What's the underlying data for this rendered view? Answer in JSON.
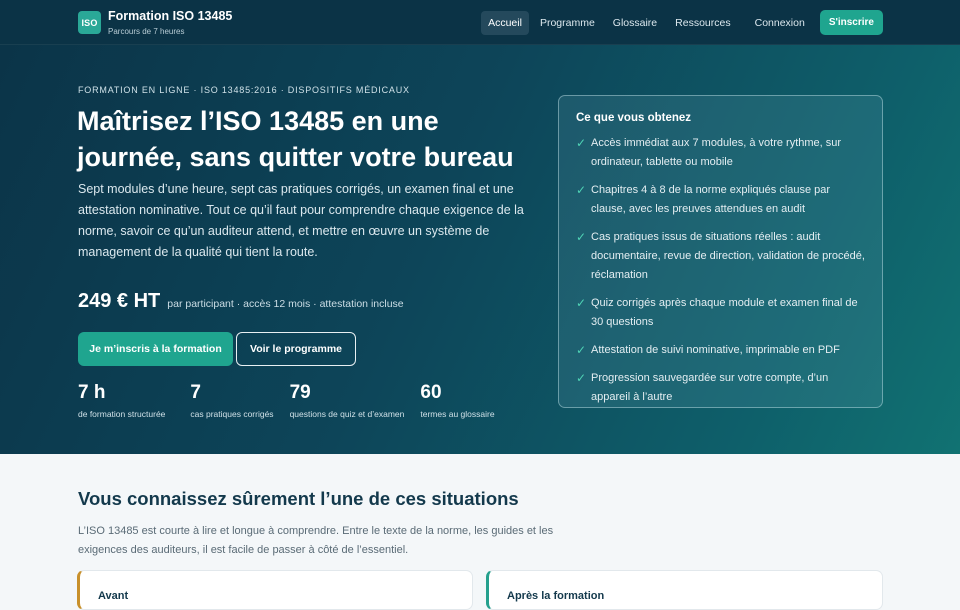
{
  "header": {
    "logo_text": "ISO",
    "title": "Formation ISO 13485",
    "subtitle": "Parcours de 7 heures",
    "nav": [
      "Accueil",
      "Programme",
      "Glossaire",
      "Ressources",
      "Connexion"
    ],
    "active_nav": "Accueil",
    "cta": "S'inscrire"
  },
  "hero": {
    "eyebrow": "FORMATION EN LIGNE · ISO 13485:2016 · DISPOSITIFS MÉDICAUX",
    "title": "Maîtrisez l’ISO 13485 en une journée, sans quitter votre bureau",
    "description": "Sept modules d’une heure, sept cas pratiques corrigés, un examen final et une attestation nominative. Tout ce qu’il faut pour comprendre chaque exigence de la norme, savoir ce qu’un auditeur attend, et mettre en œuvre un système de management de la qualité qui tient la route.",
    "price": "249 € HT",
    "price_note": "par participant · accès 12 mois · attestation incluse",
    "primary_button": "Je m’inscris à la formation",
    "secondary_button": "Voir le programme",
    "stats": [
      {
        "value": "7 h",
        "label": "de formation structurée"
      },
      {
        "value": "7",
        "label": "cas pratiques corrigés"
      },
      {
        "value": "79",
        "label": "questions de quiz et d’examen"
      },
      {
        "value": "60",
        "label": "termes au glossaire"
      }
    ]
  },
  "card": {
    "title": "Ce que vous obtenez",
    "items": [
      "Accès immédiat aux 7 modules, à votre rythme, sur ordinateur, tablette ou mobile",
      "Chapitres 4 à 8 de la norme expliqués clause par clause, avec les preuves attendues en audit",
      "Cas pratiques issus de situations réelles : audit documentaire, revue de direction, validation de procédé, réclamation",
      "Quiz corrigés après chaque module et examen final de 30 questions",
      "Attestation de suivi nominative, imprimable en PDF",
      "Progression sauvegardée sur votre compte, d’un appareil à l’autre"
    ]
  },
  "section": {
    "title": "Vous connaissez sûrement l’une de ces situations",
    "description": "L’ISO 13485 est courte à lire et longue à comprendre. Entre le texte de la norme, les guides et les exigences des auditeurs, il est facile de passer à côté de l’essentiel.",
    "before_title": "Avant",
    "after_title": "Après la formation"
  },
  "colors": {
    "accent": "#1fa58f",
    "header_bg": "#0b3346",
    "before_accent": "#c8902b",
    "after_accent": "#25a08d"
  }
}
